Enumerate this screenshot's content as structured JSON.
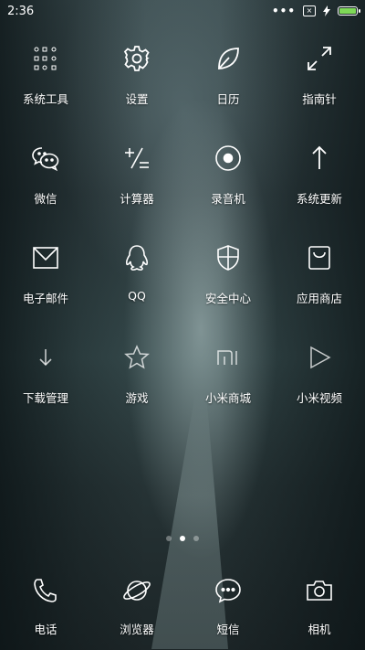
{
  "status": {
    "time": "2:36",
    "signal_dots": "•••",
    "battery_level": 1.0,
    "battery_color": "#7ed957"
  },
  "apps": [
    {
      "label": "系统工具",
      "icon": "folder-grid-icon"
    },
    {
      "label": "设置",
      "icon": "gear-icon"
    },
    {
      "label": "日历",
      "icon": "leaf-icon"
    },
    {
      "label": "指南针",
      "icon": "expand-arrows-icon"
    },
    {
      "label": "微信",
      "icon": "wechat-icon"
    },
    {
      "label": "计算器",
      "icon": "calculator-icon"
    },
    {
      "label": "录音机",
      "icon": "record-icon"
    },
    {
      "label": "系统更新",
      "icon": "arrow-up-icon"
    },
    {
      "label": "电子邮件",
      "icon": "envelope-icon"
    },
    {
      "label": "QQ",
      "icon": "penguin-icon"
    },
    {
      "label": "安全中心",
      "icon": "shield-icon"
    },
    {
      "label": "应用商店",
      "icon": "shopping-bag-icon"
    },
    {
      "label": "下载管理",
      "icon": "download-arrow-icon"
    },
    {
      "label": "游戏",
      "icon": "star-icon"
    },
    {
      "label": "小米商城",
      "icon": "mi-logo-icon"
    },
    {
      "label": "小米视频",
      "icon": "play-icon"
    }
  ],
  "pager": {
    "pages": 3,
    "active": 2
  },
  "dock": [
    {
      "label": "电话",
      "icon": "phone-icon"
    },
    {
      "label": "浏览器",
      "icon": "planet-icon"
    },
    {
      "label": "短信",
      "icon": "chat-bubble-icon"
    },
    {
      "label": "相机",
      "icon": "camera-icon"
    }
  ]
}
